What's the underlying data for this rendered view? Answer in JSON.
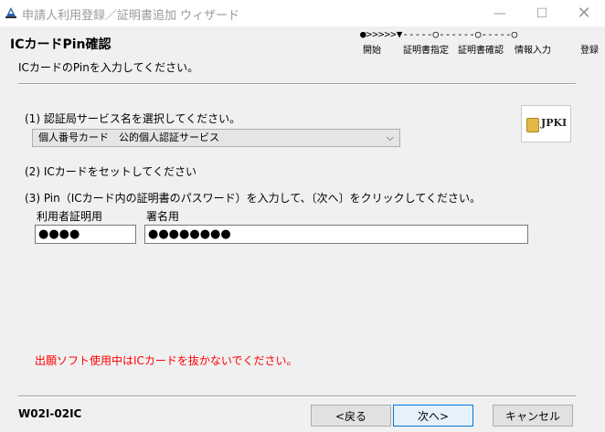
{
  "window": {
    "title": "申請人利用登録／証明書追加 ウィザード",
    "minimize_glyph": "—",
    "maximize_glyph": "☐",
    "close_glyph": "✕"
  },
  "header": {
    "title": "ICカードPin確認",
    "instruction": "ICカードのPinを入力してください。",
    "steps_track": "●>>>>>▼-----○------○-----○",
    "steps": [
      "開始",
      "証明書指定",
      "証明書確認",
      "情報入力",
      "登録"
    ]
  },
  "step1": {
    "label": "(1) 認証局サービス名を選択してください。",
    "select_value": "個人番号カード　公的個人認証サービス"
  },
  "jpki": {
    "text": "JPKI",
    "icon": "ic-card-chip-icon"
  },
  "step2": {
    "label": "(2) ICカードをセットしてください"
  },
  "step3": {
    "label": "(3) Pin（ICカード内の証明書のパスワード）を入力して、〔次へ〕をクリックしてください。",
    "user_cert_label": "利用者証明用",
    "user_cert_value": "●●●●",
    "sign_label": "署名用",
    "sign_value": "●●●●●●●●"
  },
  "warning": {
    "text": "出願ソフト使用中はICカードを抜かないでください。",
    "color": "#ff0000"
  },
  "footer": {
    "code": "W02I-02IC",
    "back_label": "<戻る",
    "next_label": "次へ>",
    "cancel_label": "キャンセル"
  }
}
